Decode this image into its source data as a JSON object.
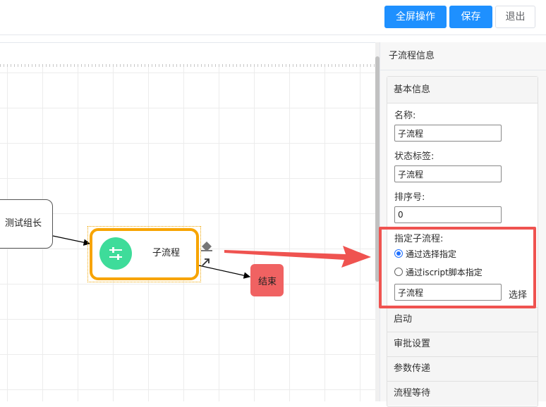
{
  "toolbar": {
    "fullscreen_label": "全屏操作",
    "save_label": "保存",
    "exit_label": "退出"
  },
  "canvas": {
    "task_node_label": "测试组长",
    "subprocess_node_label": "子流程",
    "end_node_label": "结束"
  },
  "panel": {
    "title": "子流程信息",
    "basic_section": "基本信息",
    "name_label": "名称:",
    "name_value": "子流程",
    "status_label": "状态标签:",
    "status_value": "子流程",
    "order_label": "排序号:",
    "order_value": "0",
    "assign_label": "指定子流程:",
    "radio_select": "通过选择指定",
    "radio_script": "通过iscript脚本指定",
    "subprocess_value": "子流程",
    "select_button": "选择",
    "sections": [
      "启动",
      "审批设置",
      "参数传递",
      "流程等待"
    ]
  },
  "colors": {
    "primary": "#1e90ff",
    "subprocess_border": "#f7a400",
    "subprocess_icon": "#3edc9a",
    "end_node": "#f06262",
    "annotation": "#ef5350"
  }
}
